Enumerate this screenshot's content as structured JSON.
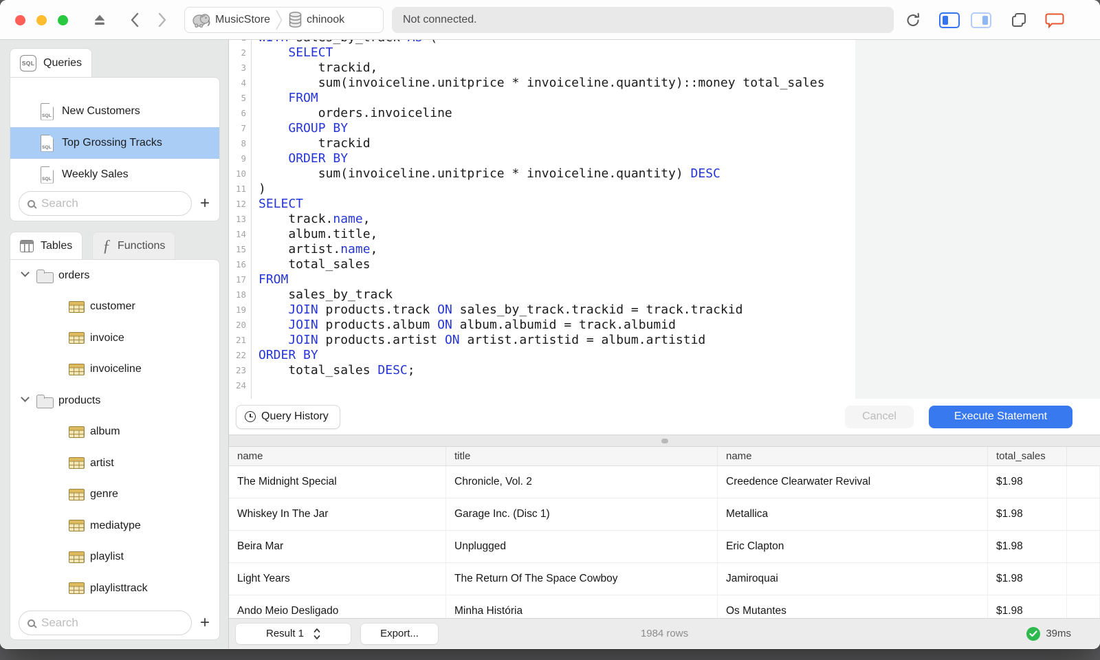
{
  "toolbar": {
    "status": "Not connected.",
    "breadcrumb": [
      {
        "label": "MusicStore",
        "icon": "postgres-elephant"
      },
      {
        "label": "chinook",
        "icon": "database"
      }
    ]
  },
  "sidebar": {
    "queries": {
      "tab_label": "Queries",
      "items": [
        {
          "label": "New Customers",
          "selected": false
        },
        {
          "label": "Top Grossing Tracks",
          "selected": true
        },
        {
          "label": "Weekly Sales",
          "selected": false
        }
      ],
      "search_placeholder": "Search",
      "add_label": "+"
    },
    "tables": {
      "tab_label": "Tables",
      "functions_tab_label": "Functions",
      "tree": [
        {
          "label": "orders",
          "type": "folder",
          "expanded": true
        },
        {
          "label": "customer",
          "type": "table"
        },
        {
          "label": "invoice",
          "type": "table"
        },
        {
          "label": "invoiceline",
          "type": "table"
        },
        {
          "label": "products",
          "type": "folder",
          "expanded": true
        },
        {
          "label": "album",
          "type": "table"
        },
        {
          "label": "artist",
          "type": "table"
        },
        {
          "label": "genre",
          "type": "table"
        },
        {
          "label": "mediatype",
          "type": "table"
        },
        {
          "label": "playlist",
          "type": "table"
        },
        {
          "label": "playlisttrack",
          "type": "table"
        }
      ],
      "search_placeholder": "Search",
      "add_label": "+"
    }
  },
  "editor": {
    "lines": [
      [
        [
          "WITH",
          1
        ],
        [
          " sales_by_track ",
          0
        ],
        [
          "AS",
          1
        ],
        [
          " (",
          0
        ]
      ],
      [
        [
          "    ",
          0
        ],
        [
          "SELECT",
          1
        ]
      ],
      [
        [
          "        trackid,",
          0
        ]
      ],
      [
        [
          "        sum(invoiceline.unitprice * invoiceline.quantity)::money total_sales",
          0
        ]
      ],
      [
        [
          "    ",
          0
        ],
        [
          "FROM",
          1
        ]
      ],
      [
        [
          "        orders.invoiceline",
          0
        ]
      ],
      [
        [
          "    ",
          0
        ],
        [
          "GROUP BY",
          1
        ]
      ],
      [
        [
          "        trackid",
          0
        ]
      ],
      [
        [
          "    ",
          0
        ],
        [
          "ORDER BY",
          1
        ]
      ],
      [
        [
          "        sum(invoiceline.unitprice * invoiceline.quantity) ",
          0
        ],
        [
          "DESC",
          1
        ]
      ],
      [
        [
          ")",
          0
        ]
      ],
      [
        [
          "SELECT",
          1
        ]
      ],
      [
        [
          "    track.",
          0
        ],
        [
          "name",
          1
        ],
        [
          ",",
          0
        ]
      ],
      [
        [
          "    album.title,",
          0
        ]
      ],
      [
        [
          "    artist.",
          0
        ],
        [
          "name",
          1
        ],
        [
          ",",
          0
        ]
      ],
      [
        [
          "    total_sales",
          0
        ]
      ],
      [
        [
          "FROM",
          1
        ]
      ],
      [
        [
          "    sales_by_track",
          0
        ]
      ],
      [
        [
          "    ",
          0
        ],
        [
          "JOIN",
          1
        ],
        [
          " products.track ",
          0
        ],
        [
          "ON",
          1
        ],
        [
          " sales_by_track.trackid = track.trackid",
          0
        ]
      ],
      [
        [
          "    ",
          0
        ],
        [
          "JOIN",
          1
        ],
        [
          " products.album ",
          0
        ],
        [
          "ON",
          1
        ],
        [
          " album.albumid = track.albumid",
          0
        ]
      ],
      [
        [
          "    ",
          0
        ],
        [
          "JOIN",
          1
        ],
        [
          " products.artist ",
          0
        ],
        [
          "ON",
          1
        ],
        [
          " artist.artistid = album.artistid",
          0
        ]
      ],
      [
        [
          "ORDER BY",
          1
        ]
      ],
      [
        [
          "    total_sales ",
          0
        ],
        [
          "DESC",
          1
        ],
        [
          ";",
          0
        ]
      ],
      [
        [
          "",
          0
        ]
      ]
    ]
  },
  "actions": {
    "query_history": "Query History",
    "cancel": "Cancel",
    "execute": "Execute Statement"
  },
  "results": {
    "columns": [
      "name",
      "title",
      "name",
      "total_sales"
    ],
    "rows": [
      [
        "The Midnight Special",
        "Chronicle, Vol. 2",
        "Creedence Clearwater Revival",
        "$1.98"
      ],
      [
        "Whiskey In The Jar",
        "Garage Inc. (Disc 1)",
        "Metallica",
        "$1.98"
      ],
      [
        "Beira Mar",
        "Unplugged",
        "Eric Clapton",
        "$1.98"
      ],
      [
        "Light Years",
        "The Return Of The Space Cowboy",
        "Jamiroquai",
        "$1.98"
      ],
      [
        "Ando Meio Desligado",
        "Minha História",
        "Os Mutantes",
        "$1.98"
      ]
    ],
    "footer": {
      "result_selector": "Result 1",
      "export_label": "Export...",
      "row_count": "1984 rows",
      "duration": "39ms"
    }
  },
  "colors": {
    "accent": "#3879f0",
    "selection": "#a9cdf5",
    "keyword_blue": "#2636d6",
    "success_green": "#2eb94e",
    "chat_orange": "#e8552e"
  }
}
